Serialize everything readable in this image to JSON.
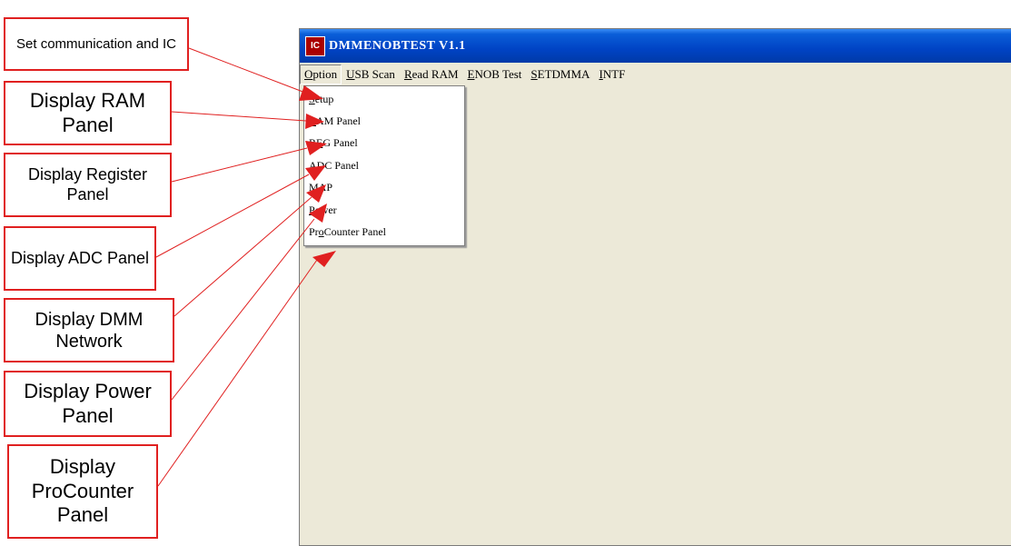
{
  "callouts": [
    "Set communication and IC",
    "Display RAM Panel",
    "Display Register Panel",
    "Display ADC Panel",
    "Display DMM Network",
    "Display Power Panel",
    "Display ProCounter Panel"
  ],
  "window": {
    "icon_text": "IC",
    "title": "DMMENOBTEST V1.1"
  },
  "menu": [
    {
      "label": "Option",
      "mnemonic": "O",
      "rest": "ption"
    },
    {
      "label": "USB Scan",
      "mnemonic": "U",
      "rest": "SB Scan"
    },
    {
      "label": "Read RAM",
      "mnemonic": "R",
      "rest": "ead RAM"
    },
    {
      "label": "ENOB Test",
      "mnemonic": "E",
      "rest": "NOB Test"
    },
    {
      "label": "SETDMMA",
      "mnemonic": "S",
      "rest": "ETDMMA"
    },
    {
      "label": "INTF",
      "mnemonic": "I",
      "rest": "NTF"
    }
  ],
  "dropdown": [
    {
      "label": "Setup",
      "pre": "",
      "mnemonic": "S",
      "rest": "etup"
    },
    {
      "label": "RAM Panel",
      "pre": "",
      "mnemonic": "R",
      "rest": "AM Panel"
    },
    {
      "label": "REG Panel",
      "pre": "R",
      "mnemonic": "E",
      "rest": "G Panel"
    },
    {
      "label": "ADC Panel",
      "pre": "",
      "mnemonic": "A",
      "rest": "DC Panel"
    },
    {
      "label": "MAP",
      "pre": "",
      "mnemonic": "M",
      "rest": "AP"
    },
    {
      "label": "Power",
      "pre": "",
      "mnemonic": "P",
      "rest": "ower"
    },
    {
      "label": "ProCounter Panel",
      "pre": "Pr",
      "mnemonic": "o",
      "rest": "Counter Panel"
    }
  ],
  "colors": {
    "annotation": "#e02020",
    "title_bar": "#0043c4",
    "client_area": "#ece9d8"
  }
}
